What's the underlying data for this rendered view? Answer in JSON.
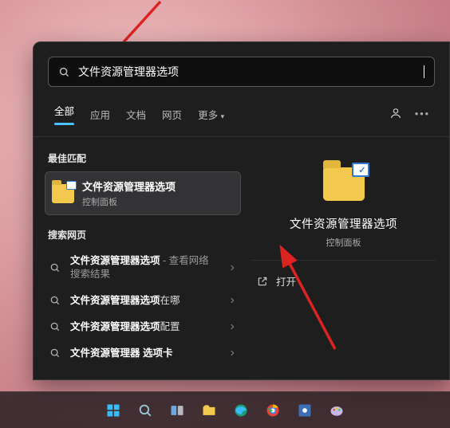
{
  "search": {
    "query": "文件资源管理器选项"
  },
  "tabs": {
    "all": "全部",
    "apps": "应用",
    "docs": "文档",
    "web": "网页",
    "more": "更多"
  },
  "sections": {
    "best_match": "最佳匹配",
    "search_web": "搜索网页"
  },
  "best": {
    "title": "文件资源管理器选项",
    "subtitle": "控制面板"
  },
  "results": [
    {
      "bold": "文件资源管理器选项",
      "suffix": " - 查看网络搜索结果",
      "multiline": true
    },
    {
      "bold": "文件资源管理器选项",
      "suffix": "在哪"
    },
    {
      "bold": "文件资源管理器选项",
      "suffix": "配置"
    },
    {
      "bold": "文件资源管理器 选项卡",
      "suffix": ""
    }
  ],
  "detail": {
    "title": "文件资源管理器选项",
    "subtitle": "控制面板",
    "open": "打开"
  },
  "taskbar": [
    "start",
    "search",
    "taskview",
    "explorer",
    "edge",
    "chrome",
    "settings",
    "paint"
  ]
}
